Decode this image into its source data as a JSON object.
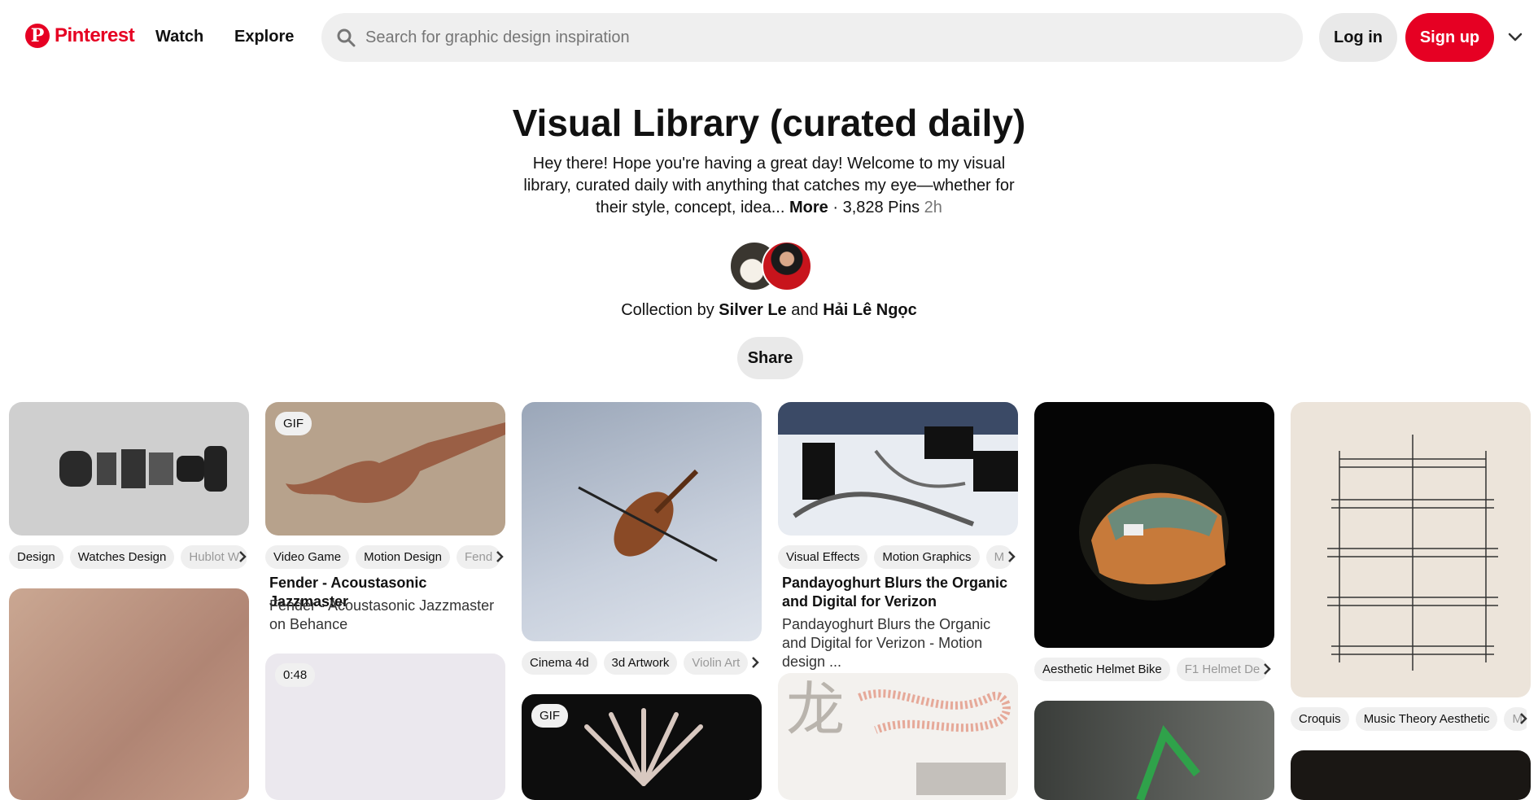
{
  "header": {
    "logo_text": "Pinterest",
    "nav": [
      "Watch",
      "Explore"
    ],
    "search_placeholder": "Search for graphic design inspiration",
    "login_label": "Log in",
    "signup_label": "Sign up"
  },
  "board": {
    "title": "Visual Library (curated daily)",
    "description": "Hey there! Hope you're having a great day! Welcome to my visual library, curated daily with anything that catches my eye—whether for their style, concept, idea...",
    "more_label": "More",
    "separator": "·",
    "pins_count": "3,828 Pins",
    "time": "2h",
    "collection_prefix": "Collection by",
    "owner1": "Silver Le",
    "and_word": "and",
    "owner2": "Hải Lê Ngọc",
    "share_label": "Share"
  },
  "pins": {
    "p1": {
      "tags": [
        "Design",
        "Watches Design",
        "Hublot W"
      ]
    },
    "p2": {
      "badge": "GIF",
      "tags": [
        "Video Game",
        "Motion Design",
        "Fend"
      ],
      "title": "Fender - Acoustasonic Jazzmaster",
      "subtitle": "Fender - Acoustasonic Jazzmaster on Behance"
    },
    "p3": {
      "tags": [
        "Cinema 4d",
        "3d Artwork",
        "Violin Art"
      ]
    },
    "p4": {
      "tags": [
        "Visual Effects",
        "Motion Graphics",
        "M"
      ],
      "title": "Pandayoghurt Blurs the Organic and Digital for Verizon",
      "subtitle": "Pandayoghurt Blurs the Organic and Digital for Verizon - Motion design ..."
    },
    "p5": {
      "tags": [
        "Aesthetic Helmet Bike",
        "F1 Helmet De"
      ]
    },
    "p6": {
      "tags": [
        "Croquis",
        "Music Theory Aesthetic",
        "M"
      ]
    },
    "p8": {
      "badge": "0:48"
    },
    "p9": {
      "badge": "GIF"
    }
  },
  "colors": {
    "brand": "#e60023",
    "chip": "#efefef"
  }
}
